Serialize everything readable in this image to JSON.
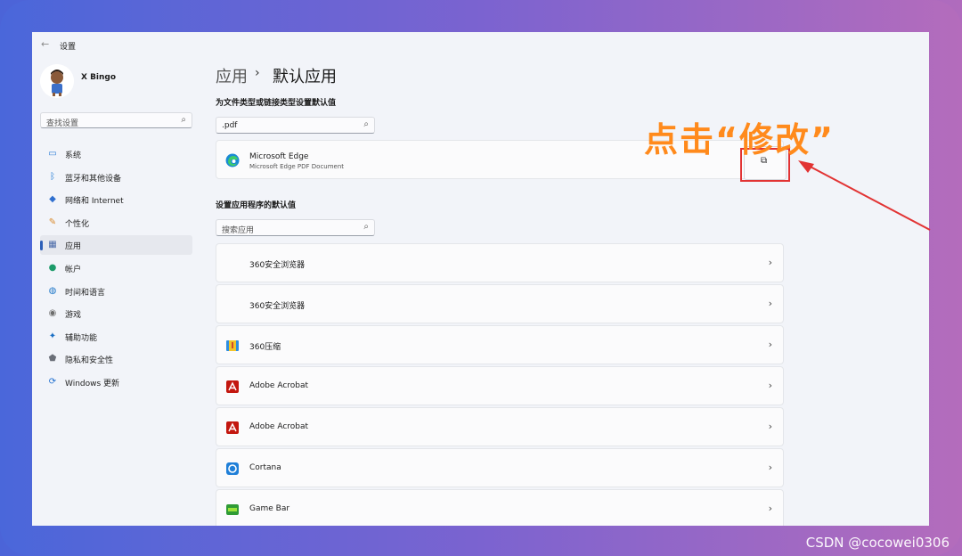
{
  "window": {
    "back_glyph": "←",
    "title": "设置"
  },
  "user": {
    "name": "X Bingo"
  },
  "sidebar": {
    "search_placeholder": "查找设置",
    "items": [
      {
        "label": "系统",
        "icon": "monitor-icon",
        "color": "#2b7bd6"
      },
      {
        "label": "蓝牙和其他设备",
        "icon": "bluetooth-icon",
        "color": "#1e79d4"
      },
      {
        "label": "网络和 Internet",
        "icon": "wifi-icon",
        "color": "#2f6fcf"
      },
      {
        "label": "个性化",
        "icon": "brush-icon",
        "color": "#d98a2b"
      },
      {
        "label": "应用",
        "icon": "apps-icon",
        "color": "#4a6aa8",
        "active": true
      },
      {
        "label": "帐户",
        "icon": "person-icon",
        "color": "#1d9b6a"
      },
      {
        "label": "时间和语言",
        "icon": "globe-clock-icon",
        "color": "#2279c9"
      },
      {
        "label": "游戏",
        "icon": "gamepad-icon",
        "color": "#6d6d6d"
      },
      {
        "label": "辅助功能",
        "icon": "accessibility-icon",
        "color": "#1a6fc4"
      },
      {
        "label": "隐私和安全性",
        "icon": "shield-icon",
        "color": "#6b6f78"
      },
      {
        "label": "Windows 更新",
        "icon": "update-icon",
        "color": "#1f6fcf"
      }
    ]
  },
  "breadcrumb": {
    "parent": "应用",
    "separator": "›",
    "current": "默认应用"
  },
  "filetype_section": {
    "title": "为文件类型或链接类型设置默认值",
    "search_value": ".pdf",
    "result": {
      "name": "Microsoft Edge",
      "subtitle": "Microsoft Edge PDF Document",
      "action_glyph": "⧉"
    }
  },
  "apps_section": {
    "title": "设置应用程序的默认值",
    "search_placeholder": "搜索应用",
    "apps": [
      {
        "name": "360安全浏览器",
        "icon": "none"
      },
      {
        "name": "360安全浏览器",
        "icon": "none"
      },
      {
        "name": "360压缩",
        "icon": "archive-icon"
      },
      {
        "name": "Adobe Acrobat",
        "icon": "acrobat-icon"
      },
      {
        "name": "Adobe Acrobat",
        "icon": "acrobat-icon"
      },
      {
        "name": "Cortana",
        "icon": "cortana-icon"
      },
      {
        "name": "Game Bar",
        "icon": "gamebar-icon"
      }
    ],
    "chevron": "›"
  },
  "annotation": {
    "text": "点击“修改”",
    "color": "#ff8a1c",
    "box_color": "#e23333"
  },
  "watermark": "CSDN @cocowei0306"
}
